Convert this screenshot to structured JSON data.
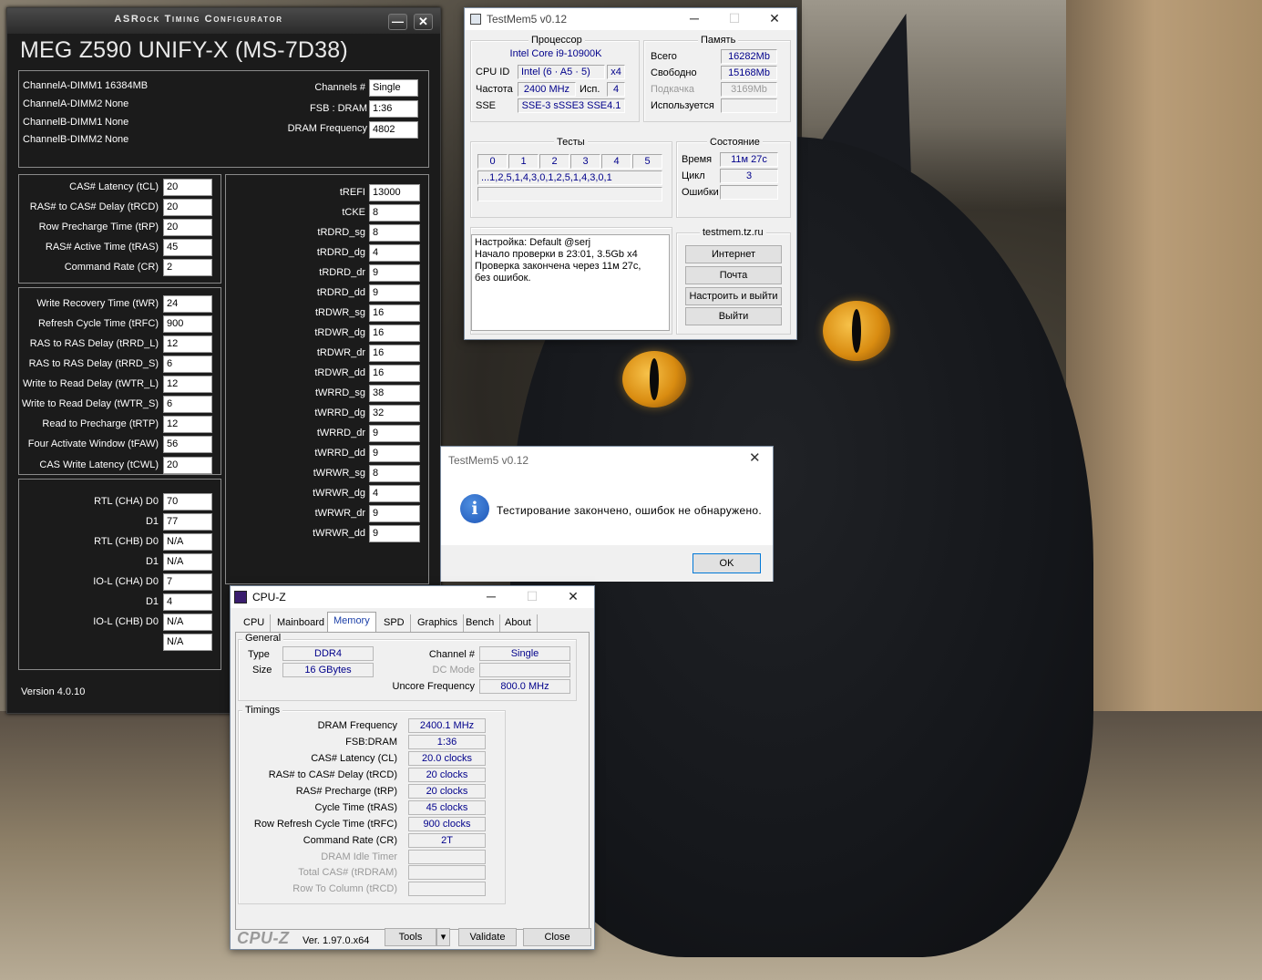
{
  "asrock": {
    "title": "ASRock Timing Configurator",
    "board": "MEG Z590 UNIFY-X (MS-7D38)",
    "dimms": [
      {
        "slot": "ChannelA-DIMM1",
        "value": "16384MB"
      },
      {
        "slot": "ChannelA-DIMM2",
        "value": "None"
      },
      {
        "slot": "ChannelB-DIMM1",
        "value": "None"
      },
      {
        "slot": "ChannelB-DIMM2",
        "value": "None"
      }
    ],
    "channels_label": "Channels #",
    "channels_value": "Single",
    "fsb_label": "FSB : DRAM",
    "fsb_value": "1:36",
    "dram_freq_label": "DRAM Frequency",
    "dram_freq_value": "4802",
    "primary": [
      {
        "label": "CAS# Latency (tCL)",
        "value": "20"
      },
      {
        "label": "RAS# to CAS# Delay (tRCD)",
        "value": "20"
      },
      {
        "label": "Row Precharge Time (tRP)",
        "value": "20"
      },
      {
        "label": "RAS# Active Time (tRAS)",
        "value": "45"
      },
      {
        "label": "Command Rate (CR)",
        "value": "2"
      }
    ],
    "secondary": [
      {
        "label": "Write Recovery Time (tWR)",
        "value": "24"
      },
      {
        "label": "Refresh Cycle Time (tRFC)",
        "value": "900"
      },
      {
        "label": "RAS to RAS Delay (tRRD_L)",
        "value": "12"
      },
      {
        "label": "RAS to RAS Delay (tRRD_S)",
        "value": "6"
      },
      {
        "label": "Write to Read Delay (tWTR_L)",
        "value": "12"
      },
      {
        "label": "Write to Read Delay (tWTR_S)",
        "value": "6"
      },
      {
        "label": "Read to Precharge (tRTP)",
        "value": "12"
      },
      {
        "label": "Four Activate Window (tFAW)",
        "value": "56"
      },
      {
        "label": "CAS Write Latency (tCWL)",
        "value": "20"
      }
    ],
    "rtl": [
      {
        "label": "RTL (CHA) D0",
        "value": "70"
      },
      {
        "label": "D1",
        "value": "77"
      },
      {
        "label": "RTL (CHB) D0",
        "value": "N/A"
      },
      {
        "label": "D1",
        "value": "N/A"
      },
      {
        "label": "IO-L (CHA) D0",
        "value": "7"
      },
      {
        "label": "D1",
        "value": "4"
      },
      {
        "label": "IO-L (CHB) D0",
        "value": "N/A"
      },
      {
        "label": "",
        "value": "N/A"
      }
    ],
    "tertiary": [
      {
        "label": "tREFI",
        "value": "13000"
      },
      {
        "label": "tCKE",
        "value": "8"
      },
      {
        "label": "tRDRD_sg",
        "value": "8"
      },
      {
        "label": "tRDRD_dg",
        "value": "4"
      },
      {
        "label": "tRDRD_dr",
        "value": "9"
      },
      {
        "label": "tRDRD_dd",
        "value": "9"
      },
      {
        "label": "tRDWR_sg",
        "value": "16"
      },
      {
        "label": "tRDWR_dg",
        "value": "16"
      },
      {
        "label": "tRDWR_dr",
        "value": "16"
      },
      {
        "label": "tRDWR_dd",
        "value": "16"
      },
      {
        "label": "tWRRD_sg",
        "value": "38"
      },
      {
        "label": "tWRRD_dg",
        "value": "32"
      },
      {
        "label": "tWRRD_dr",
        "value": "9"
      },
      {
        "label": "tWRRD_dd",
        "value": "9"
      },
      {
        "label": "tWRWR_sg",
        "value": "8"
      },
      {
        "label": "tWRWR_dg",
        "value": "4"
      },
      {
        "label": "tWRWR_dr",
        "value": "9"
      },
      {
        "label": "tWRWR_dd",
        "value": "9"
      }
    ],
    "version": "Version 4.0.10",
    "minimize_glyph": "—",
    "close_glyph": "✕"
  },
  "tm5": {
    "title": "TestMem5 v0.12",
    "cpu_group": "Процессор",
    "cpu_name": "Intel Core i9-10900K",
    "cpuid_label": "CPU ID",
    "cpuid_value": "Intel  (6 · A5 · 5)",
    "cpuid_threads": "x4",
    "freq_label": "Частота",
    "freq_value": "2400 MHz",
    "use_label": "Исп.",
    "use_value": "4",
    "sse_label": "SSE",
    "sse_value": "SSE-3 sSSE3 SSE4.1",
    "mem_group": "Память",
    "total_label": "Всего",
    "total_value": "16282Mb",
    "free_label": "Свободно",
    "free_value": "15168Mb",
    "swap_label": "Подкачка",
    "swap_value": "3169Mb",
    "used_label": "Используется",
    "used_value": "",
    "tests_group": "Тесты",
    "test_cols": [
      "0",
      "1",
      "2",
      "3",
      "4",
      "5"
    ],
    "test_sequence": "...1,2,5,1,4,3,0,1,2,5,1,4,3,0,1",
    "state_group": "Состояние",
    "time_label": "Время",
    "time_value": "11м 27с",
    "cycle_label": "Цикл",
    "cycle_value": "3",
    "errors_label": "Ошибки",
    "errors_value": "",
    "log_lines": [
      "Настройка: Default @serj",
      "Начало проверки в 23:01, 3.5Gb x4",
      "Проверка закончена через 11м 27с,",
      "без ошибок."
    ],
    "site_group": "testmem.tz.ru",
    "btn_internet": "Интернет",
    "btn_mail": "Почта",
    "btn_configure": "Настроить и выйти",
    "btn_exit": "Выйти"
  },
  "dialog": {
    "title": "TestMem5 v0.12",
    "message": "Тестирование закончено, ошибок не обнаружено.",
    "ok": "OK"
  },
  "cpuz": {
    "title": "CPU-Z",
    "tabs": [
      "CPU",
      "Mainboard",
      "Memory",
      "SPD",
      "Graphics",
      "Bench",
      "About"
    ],
    "general_group": "General",
    "type_label": "Type",
    "type_value": "DDR4",
    "size_label": "Size",
    "size_value": "16 GBytes",
    "channel_label": "Channel #",
    "channel_value": "Single",
    "dcmode_label": "DC Mode",
    "dcmode_value": "",
    "uncore_label": "Uncore Frequency",
    "uncore_value": "800.0 MHz",
    "timings_group": "Timings",
    "timings": [
      {
        "label": "DRAM Frequency",
        "value": "2400.1 MHz"
      },
      {
        "label": "FSB:DRAM",
        "value": "1:36"
      },
      {
        "label": "CAS# Latency (CL)",
        "value": "20.0 clocks"
      },
      {
        "label": "RAS# to CAS# Delay (tRCD)",
        "value": "20 clocks"
      },
      {
        "label": "RAS# Precharge (tRP)",
        "value": "20 clocks"
      },
      {
        "label": "Cycle Time (tRAS)",
        "value": "45 clocks"
      },
      {
        "label": "Row Refresh Cycle Time (tRFC)",
        "value": "900 clocks"
      },
      {
        "label": "Command Rate (CR)",
        "value": "2T"
      },
      {
        "label": "DRAM Idle Timer",
        "value": ""
      },
      {
        "label": "Total CAS# (tRDRAM)",
        "value": ""
      },
      {
        "label": "Row To Column (tRCD)",
        "value": ""
      }
    ],
    "brand": "CPU-Z",
    "version": "Ver. 1.97.0.x64",
    "tools": "Tools",
    "validate": "Validate",
    "close": "Close"
  }
}
